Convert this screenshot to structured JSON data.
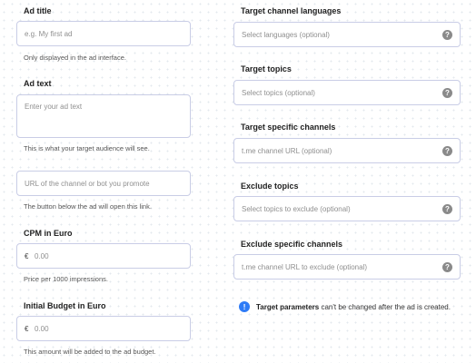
{
  "left": {
    "ad_title": {
      "label": "Ad title",
      "placeholder": "e.g. My first ad",
      "help": "Only displayed in the ad interface."
    },
    "ad_text": {
      "label": "Ad text",
      "placeholder": "Enter your ad text",
      "help": "This is what your target audience will see."
    },
    "url": {
      "placeholder": "URL of the channel or bot you promote",
      "help": "The button below the ad will open this link."
    },
    "cpm": {
      "label": "CPM in Euro",
      "prefix": "€",
      "value": "0.00",
      "help": "Price per 1000 impressions."
    },
    "budget": {
      "label": "Initial Budget in Euro",
      "prefix": "€",
      "value": "0.00",
      "help": "This amount will be added to the ad budget."
    }
  },
  "right": {
    "languages": {
      "label": "Target channel languages",
      "placeholder": "Select languages (optional)"
    },
    "topics": {
      "label": "Target topics",
      "placeholder": "Select topics (optional)"
    },
    "channels": {
      "label": "Target specific channels",
      "placeholder": "t.me channel URL (optional)"
    },
    "exclude_topics": {
      "label": "Exclude topics",
      "placeholder": "Select topics to exclude (optional)"
    },
    "exclude_channels": {
      "label": "Exclude specific channels",
      "placeholder": "t.me channel URL to exclude (optional)"
    }
  },
  "help_icon_glyph": "?",
  "notice": {
    "icon_glyph": "!",
    "bold": "Target parameters",
    "text": " can't be changed after the ad is created."
  },
  "colors": {
    "field_border": "#c9cde6",
    "info_icon": "#2f7cf6",
    "help_icon": "#8a8a8a"
  }
}
